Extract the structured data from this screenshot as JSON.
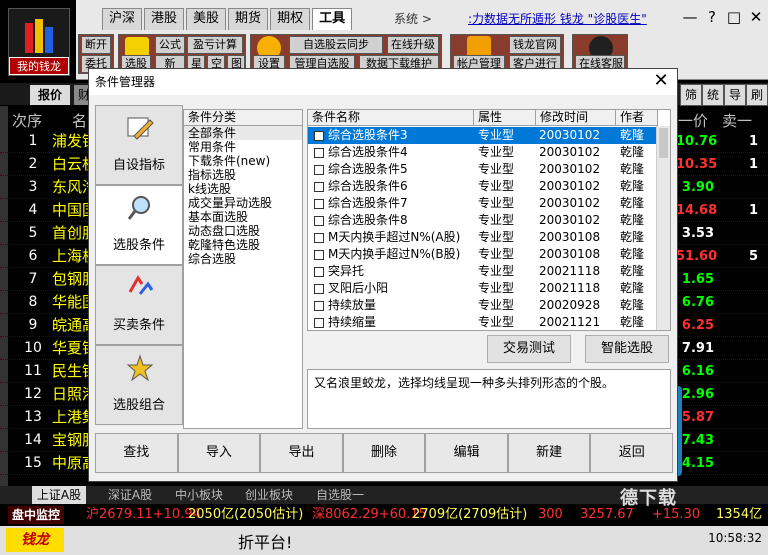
{
  "app": {
    "logo_label": "我的钱龙",
    "top_tabs": [
      "沪深",
      "港股",
      "美股",
      "期货",
      "期权",
      "工具"
    ],
    "active_top_tab": "工具",
    "system_label": "系统 >",
    "marquee": ":力数据无所遁形  钱龙 \"诊股医生\"",
    "window_buttons": [
      "—",
      "?",
      "□",
      "✕"
    ],
    "toolbar": {
      "g1": [
        "断开",
        "委托"
      ],
      "g2_big": "选股",
      "g2_big2": "新",
      "g2_small": [
        "公式",
        "盈亏计算"
      ],
      "g2_small2": [
        "新"
      ],
      "g2_tail": [
        "星",
        "空",
        "图"
      ],
      "settings": "设置",
      "cloud_sync": "自选股云同步",
      "manage_watch": "管理自选股",
      "online_upgrade": "在线升级",
      "data_download": "数据下载维护",
      "account": "帐户管理",
      "official": "钱龙官网",
      "client": "客户进行",
      "online_service": "在线客服"
    },
    "quote_tab": "报价",
    "quote_tab2": "财",
    "side_buttons": [
      "筛",
      "统",
      "导",
      "刷"
    ],
    "col_rank": "次序",
    "col_name": "名",
    "col_price": "一价",
    "col_sell": "卖一"
  },
  "stocks": [
    {
      "rank": "1",
      "name": "浦发银行",
      "price": "10.76",
      "price_color": "#00ff00",
      "rt": "1"
    },
    {
      "rank": "2",
      "name": "白云机场",
      "price": "10.35",
      "price_color": "#ff3030",
      "rt": "1"
    },
    {
      "rank": "3",
      "name": "东风汽车",
      "price": "3.90",
      "price_color": "#00ff00",
      "rt": ""
    },
    {
      "rank": "4",
      "name": "中国国贸",
      "price": "14.68",
      "price_color": "#ff3030",
      "rt": "1"
    },
    {
      "rank": "5",
      "name": "首创股份",
      "price": "3.53",
      "price_color": "#ffffff",
      "rt": ""
    },
    {
      "rank": "6",
      "name": "上海机场",
      "price": "51.60",
      "price_color": "#ff3030",
      "rt": "5"
    },
    {
      "rank": "7",
      "name": "包钢股份",
      "price": "1.65",
      "price_color": "#00ff00",
      "rt": ""
    },
    {
      "rank": "8",
      "name": "华能国际",
      "price": "6.76",
      "price_color": "#00ff00",
      "rt": ""
    },
    {
      "rank": "9",
      "name": "皖通高速",
      "price": "6.25",
      "price_color": "#ff3030",
      "rt": ""
    },
    {
      "rank": "10",
      "name": "华夏银行",
      "price": "7.91",
      "price_color": "#ffffff",
      "rt": ""
    },
    {
      "rank": "11",
      "name": "民生银行",
      "price": "6.16",
      "price_color": "#00ff00",
      "rt": ""
    },
    {
      "rank": "12",
      "name": "日照港",
      "price": "2.96",
      "price_color": "#00ff00",
      "rt": ""
    },
    {
      "rank": "13",
      "name": "上港集团",
      "price": "5.87",
      "price_color": "#ff3030",
      "rt": ""
    },
    {
      "rank": "14",
      "name": "宝钢股份",
      "price": "7.43",
      "price_color": "#00ff00",
      "rt": ""
    },
    {
      "rank": "15",
      "name": "中原高速",
      "price": "4.15",
      "price_color": "#00ff00",
      "rt": ""
    }
  ],
  "bottom_tabs": [
    "上证A股",
    "深证A股",
    "中小板块",
    "创业板块",
    "自选股一"
  ],
  "ticker": {
    "monitor": "盘中监控",
    "seg1": "沪2679.11+10.94",
    "seg2": "2050亿(2050估计)",
    "seg3": "深8062.29+60.15",
    "seg4": "2709亿(2709估计)",
    "seg5": "300",
    "seg6": "3257.67",
    "seg7": "+15.30",
    "seg8": "1354亿"
  },
  "status": {
    "logo": "钱龙",
    "text": "折平台!",
    "clock": "10:58:32"
  },
  "dialog": {
    "title": "条件管理器",
    "nav": [
      "自设指标",
      "选股条件",
      "买卖条件",
      "选股组合"
    ],
    "category_header": "条件分类",
    "categories": [
      "全部条件",
      "常用条件",
      "下载条件(new)",
      "指标选股",
      "k线选股",
      "成交量异动选股",
      "基本面选股",
      "动态盘口选股",
      "乾隆特色选股",
      "综合选股"
    ],
    "list_headers": [
      "条件名称",
      "属性",
      "修改时间",
      "作者"
    ],
    "conditions": [
      {
        "name": "综合选股条件3",
        "attr": "专业型",
        "time": "20030102",
        "author": "乾隆"
      },
      {
        "name": "综合选股条件4",
        "attr": "专业型",
        "time": "20030102",
        "author": "乾隆"
      },
      {
        "name": "综合选股条件5",
        "attr": "专业型",
        "time": "20030102",
        "author": "乾隆"
      },
      {
        "name": "综合选股条件6",
        "attr": "专业型",
        "time": "20030102",
        "author": "乾隆"
      },
      {
        "name": "综合选股条件7",
        "attr": "专业型",
        "time": "20030102",
        "author": "乾隆"
      },
      {
        "name": "综合选股条件8",
        "attr": "专业型",
        "time": "20030102",
        "author": "乾隆"
      },
      {
        "name": "M天内换手超过N%(A股)",
        "attr": "专业型",
        "time": "20030108",
        "author": "乾隆"
      },
      {
        "name": "M天内换手超过N%(B股)",
        "attr": "专业型",
        "time": "20030108",
        "author": "乾隆"
      },
      {
        "name": "突异托",
        "attr": "专业型",
        "time": "20021118",
        "author": "乾隆"
      },
      {
        "name": "叉阳后小阳",
        "attr": "专业型",
        "time": "20021118",
        "author": "乾隆"
      },
      {
        "name": "持续放量",
        "attr": "专业型",
        "time": "20020928",
        "author": "乾隆"
      },
      {
        "name": "持续缩量",
        "attr": "专业型",
        "time": "20021121",
        "author": "乾隆"
      }
    ],
    "trade_test": "交易测试",
    "smart_select": "智能选股",
    "description": "又名浪里蛟龙，选择均线呈现一种多头排列形态的个股。",
    "bottom_buttons": [
      "查找",
      "导入",
      "导出",
      "删除",
      "编辑",
      "新建",
      "返回"
    ]
  },
  "watermark": "德下载"
}
